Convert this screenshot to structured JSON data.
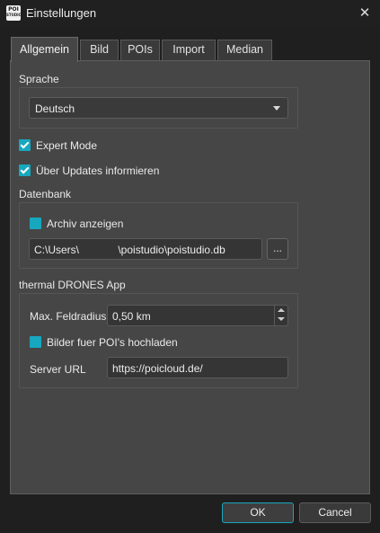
{
  "window": {
    "title": "Einstellungen",
    "app_icon_top": "POI",
    "app_icon_bottom": "STUDIO",
    "close_glyph": "✕"
  },
  "tabs": [
    {
      "label": "Allgemein",
      "active": true
    },
    {
      "label": "Bild"
    },
    {
      "label": "POIs"
    },
    {
      "label": "Import"
    },
    {
      "label": "Median"
    }
  ],
  "language": {
    "label": "Sprache",
    "selected": "Deutsch"
  },
  "options": {
    "expert_mode": {
      "label": "Expert Mode",
      "checked": true
    },
    "updates": {
      "label": "Über Updates informieren",
      "checked": true
    }
  },
  "database": {
    "label": "Datenbank",
    "show_archive": {
      "label": "Archiv anzeigen",
      "checked": false
    },
    "path": "C:\\Users\\             \\poistudio\\poistudio.db",
    "browse_label": "..."
  },
  "thermal": {
    "label": "thermal DRONES App",
    "max_radius_label": "Max. Feldradius",
    "max_radius_value": "0,50 km",
    "upload": {
      "label": "Bilder fuer POI's hochladen",
      "checked": false
    },
    "server_label": "Server URL",
    "server_value": "https://poicloud.de/"
  },
  "buttons": {
    "ok": "OK",
    "cancel": "Cancel"
  },
  "colors": {
    "accent": "#17a7bf",
    "panel": "#464646",
    "background": "#1f1f1f"
  }
}
